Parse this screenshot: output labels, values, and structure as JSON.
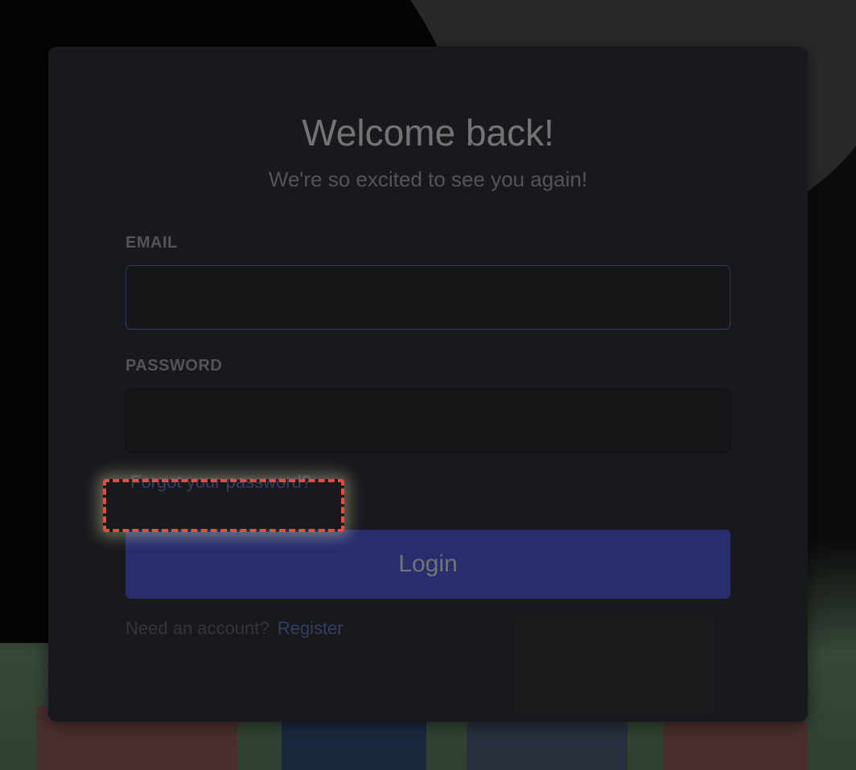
{
  "header": {
    "title": "Welcome back!",
    "subtitle": "We're so excited to see you again!"
  },
  "form": {
    "email": {
      "label": "EMAIL",
      "value": ""
    },
    "password": {
      "label": "PASSWORD",
      "value": ""
    },
    "forgot_password_label": "Forgot your password?",
    "login_button_label": "Login",
    "need_account_text": "Need an account?",
    "register_label": "Register"
  },
  "colors": {
    "accent": "#7289da",
    "button": "#5865f2",
    "card_bg": "#36393f",
    "input_bg": "#2f3136"
  },
  "highlight": {
    "target": "forgot-password-link"
  }
}
